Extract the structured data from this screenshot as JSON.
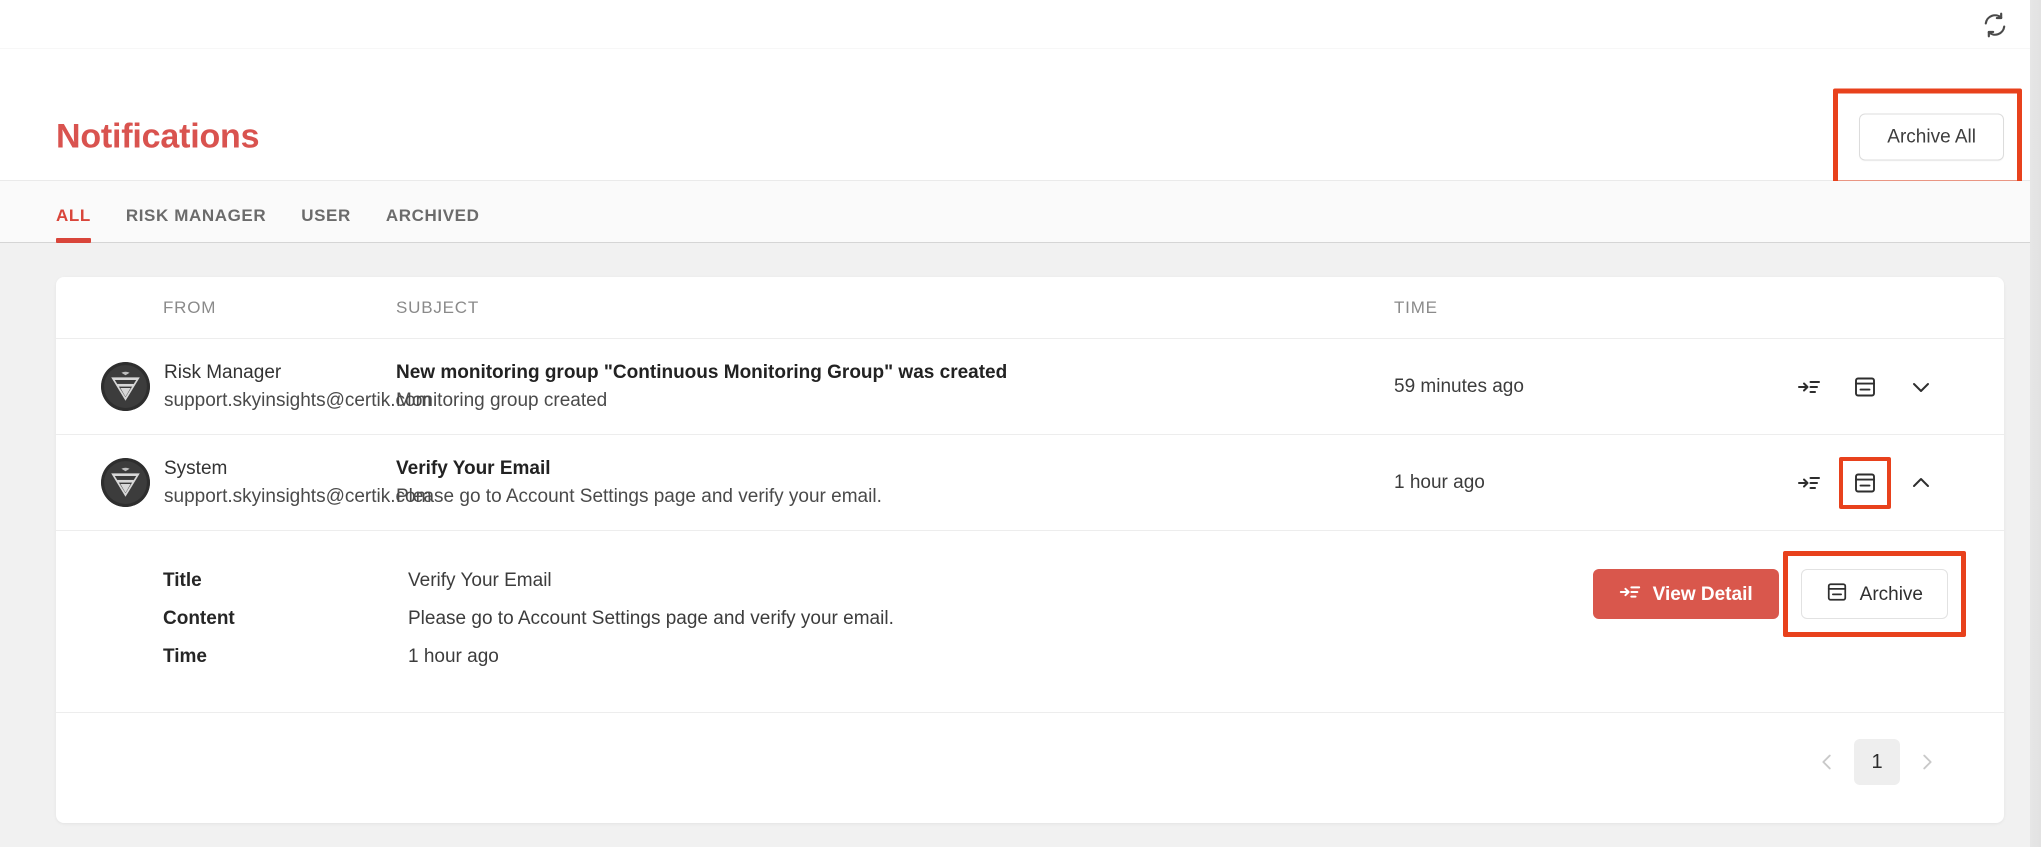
{
  "topbar": {
    "refresh_icon": "refresh-icon"
  },
  "header": {
    "title": "Notifications",
    "archive_all_label": "Archive All",
    "accent_color": "#d9453a",
    "title_color": "#d9534f"
  },
  "tabs": [
    {
      "label": "ALL",
      "active": true
    },
    {
      "label": "RISK MANAGER",
      "active": false
    },
    {
      "label": "USER",
      "active": false
    },
    {
      "label": "ARCHIVED",
      "active": false
    }
  ],
  "table": {
    "columns": {
      "from": "FROM",
      "subject": "SUBJECT",
      "time": "TIME"
    },
    "rows": [
      {
        "avatar": "certik-logo-avatar",
        "from_name": "Risk Manager",
        "from_email": "support.skyinsights@certik.com",
        "subject_title": "New monitoring group \"Continuous Monitoring Group\" was created",
        "subject_sub": "Monitoring group created",
        "time": "59 minutes ago",
        "expanded": false,
        "chevron": "chevron-down-icon"
      },
      {
        "avatar": "certik-logo-avatar",
        "from_name": "System",
        "from_email": "support.skyinsights@certik.com",
        "subject_title": "Verify Your Email",
        "subject_sub": "Please go to Account Settings page and verify your email.",
        "time": "1 hour ago",
        "expanded": true,
        "chevron": "chevron-up-icon"
      }
    ]
  },
  "detail": {
    "labels": {
      "title": "Title",
      "content": "Content",
      "time": "Time"
    },
    "values": {
      "title": "Verify Your Email",
      "content": "Please go to Account Settings page and verify your email.",
      "time": "1 hour ago"
    },
    "view_detail_label": "View Detail",
    "archive_label": "Archive"
  },
  "pagination": {
    "prev": "chevron-left-icon",
    "next": "chevron-right-icon",
    "current_page": "1"
  },
  "annotations": {
    "color": "#e8411c",
    "targets": [
      "archive-all-button",
      "row-archive-icon",
      "archive-button"
    ]
  }
}
